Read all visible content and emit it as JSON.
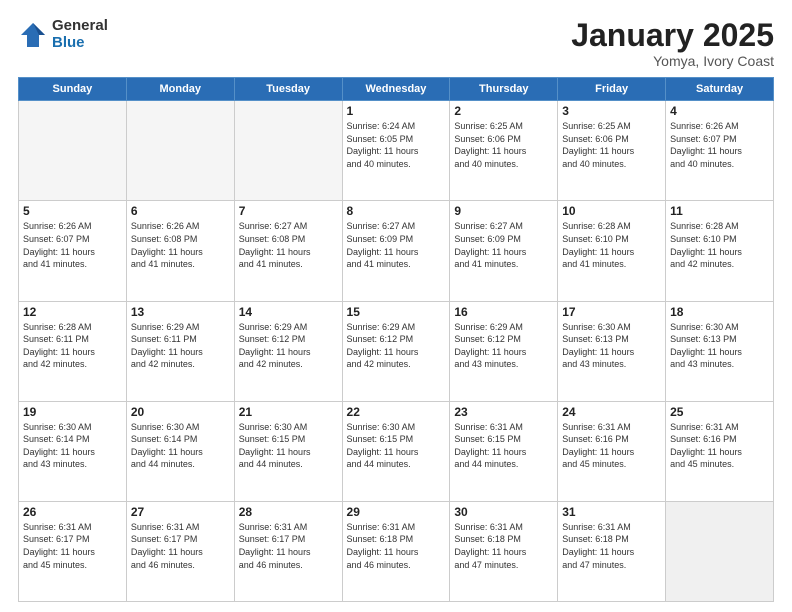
{
  "logo": {
    "general": "General",
    "blue": "Blue"
  },
  "header": {
    "month": "January 2025",
    "location": "Yomya, Ivory Coast"
  },
  "weekdays": [
    "Sunday",
    "Monday",
    "Tuesday",
    "Wednesday",
    "Thursday",
    "Friday",
    "Saturday"
  ],
  "weeks": [
    [
      {
        "day": "",
        "info": ""
      },
      {
        "day": "",
        "info": ""
      },
      {
        "day": "",
        "info": ""
      },
      {
        "day": "1",
        "info": "Sunrise: 6:24 AM\nSunset: 6:05 PM\nDaylight: 11 hours\nand 40 minutes."
      },
      {
        "day": "2",
        "info": "Sunrise: 6:25 AM\nSunset: 6:06 PM\nDaylight: 11 hours\nand 40 minutes."
      },
      {
        "day": "3",
        "info": "Sunrise: 6:25 AM\nSunset: 6:06 PM\nDaylight: 11 hours\nand 40 minutes."
      },
      {
        "day": "4",
        "info": "Sunrise: 6:26 AM\nSunset: 6:07 PM\nDaylight: 11 hours\nand 40 minutes."
      }
    ],
    [
      {
        "day": "5",
        "info": "Sunrise: 6:26 AM\nSunset: 6:07 PM\nDaylight: 11 hours\nand 41 minutes."
      },
      {
        "day": "6",
        "info": "Sunrise: 6:26 AM\nSunset: 6:08 PM\nDaylight: 11 hours\nand 41 minutes."
      },
      {
        "day": "7",
        "info": "Sunrise: 6:27 AM\nSunset: 6:08 PM\nDaylight: 11 hours\nand 41 minutes."
      },
      {
        "day": "8",
        "info": "Sunrise: 6:27 AM\nSunset: 6:09 PM\nDaylight: 11 hours\nand 41 minutes."
      },
      {
        "day": "9",
        "info": "Sunrise: 6:27 AM\nSunset: 6:09 PM\nDaylight: 11 hours\nand 41 minutes."
      },
      {
        "day": "10",
        "info": "Sunrise: 6:28 AM\nSunset: 6:10 PM\nDaylight: 11 hours\nand 41 minutes."
      },
      {
        "day": "11",
        "info": "Sunrise: 6:28 AM\nSunset: 6:10 PM\nDaylight: 11 hours\nand 42 minutes."
      }
    ],
    [
      {
        "day": "12",
        "info": "Sunrise: 6:28 AM\nSunset: 6:11 PM\nDaylight: 11 hours\nand 42 minutes."
      },
      {
        "day": "13",
        "info": "Sunrise: 6:29 AM\nSunset: 6:11 PM\nDaylight: 11 hours\nand 42 minutes."
      },
      {
        "day": "14",
        "info": "Sunrise: 6:29 AM\nSunset: 6:12 PM\nDaylight: 11 hours\nand 42 minutes."
      },
      {
        "day": "15",
        "info": "Sunrise: 6:29 AM\nSunset: 6:12 PM\nDaylight: 11 hours\nand 42 minutes."
      },
      {
        "day": "16",
        "info": "Sunrise: 6:29 AM\nSunset: 6:12 PM\nDaylight: 11 hours\nand 43 minutes."
      },
      {
        "day": "17",
        "info": "Sunrise: 6:30 AM\nSunset: 6:13 PM\nDaylight: 11 hours\nand 43 minutes."
      },
      {
        "day": "18",
        "info": "Sunrise: 6:30 AM\nSunset: 6:13 PM\nDaylight: 11 hours\nand 43 minutes."
      }
    ],
    [
      {
        "day": "19",
        "info": "Sunrise: 6:30 AM\nSunset: 6:14 PM\nDaylight: 11 hours\nand 43 minutes."
      },
      {
        "day": "20",
        "info": "Sunrise: 6:30 AM\nSunset: 6:14 PM\nDaylight: 11 hours\nand 44 minutes."
      },
      {
        "day": "21",
        "info": "Sunrise: 6:30 AM\nSunset: 6:15 PM\nDaylight: 11 hours\nand 44 minutes."
      },
      {
        "day": "22",
        "info": "Sunrise: 6:30 AM\nSunset: 6:15 PM\nDaylight: 11 hours\nand 44 minutes."
      },
      {
        "day": "23",
        "info": "Sunrise: 6:31 AM\nSunset: 6:15 PM\nDaylight: 11 hours\nand 44 minutes."
      },
      {
        "day": "24",
        "info": "Sunrise: 6:31 AM\nSunset: 6:16 PM\nDaylight: 11 hours\nand 45 minutes."
      },
      {
        "day": "25",
        "info": "Sunrise: 6:31 AM\nSunset: 6:16 PM\nDaylight: 11 hours\nand 45 minutes."
      }
    ],
    [
      {
        "day": "26",
        "info": "Sunrise: 6:31 AM\nSunset: 6:17 PM\nDaylight: 11 hours\nand 45 minutes."
      },
      {
        "day": "27",
        "info": "Sunrise: 6:31 AM\nSunset: 6:17 PM\nDaylight: 11 hours\nand 46 minutes."
      },
      {
        "day": "28",
        "info": "Sunrise: 6:31 AM\nSunset: 6:17 PM\nDaylight: 11 hours\nand 46 minutes."
      },
      {
        "day": "29",
        "info": "Sunrise: 6:31 AM\nSunset: 6:18 PM\nDaylight: 11 hours\nand 46 minutes."
      },
      {
        "day": "30",
        "info": "Sunrise: 6:31 AM\nSunset: 6:18 PM\nDaylight: 11 hours\nand 47 minutes."
      },
      {
        "day": "31",
        "info": "Sunrise: 6:31 AM\nSunset: 6:18 PM\nDaylight: 11 hours\nand 47 minutes."
      },
      {
        "day": "",
        "info": ""
      }
    ]
  ]
}
